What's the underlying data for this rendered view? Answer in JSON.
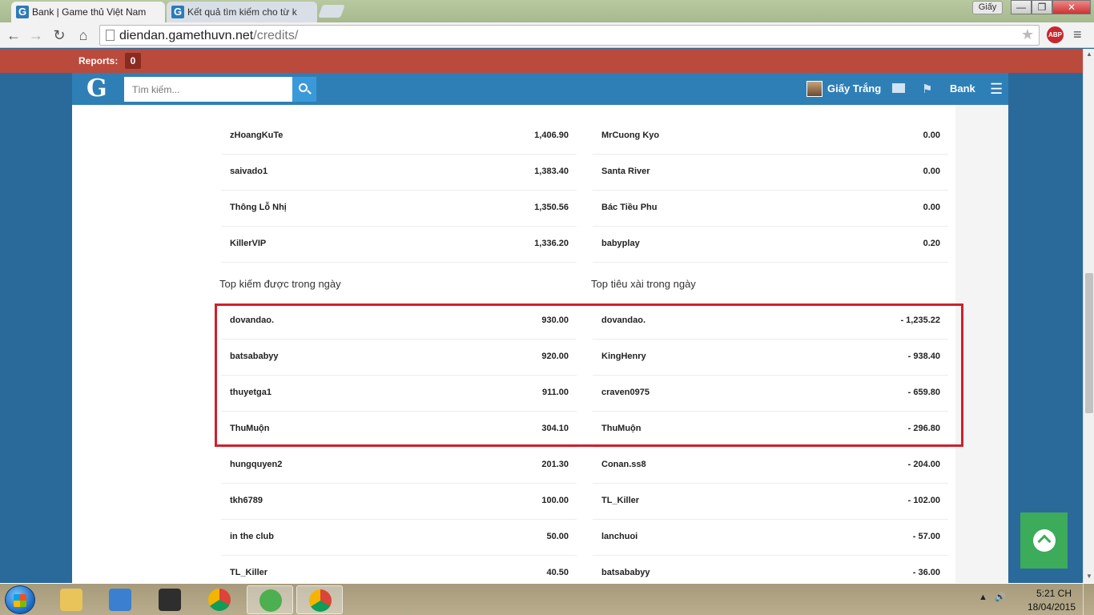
{
  "browser": {
    "tabs": [
      {
        "title": "Bank | Game thủ Việt Nam",
        "favicon": "G",
        "active": true
      },
      {
        "title": "Kết quả tìm kiếm cho từ k",
        "favicon": "G",
        "active": false
      }
    ],
    "profile_label": "Giấy",
    "url_host": "diendan.gamethuvn.net",
    "url_path": "/credits/",
    "abp_label": "ABP"
  },
  "site": {
    "reports_label": "Reports:",
    "reports_count": "0",
    "logo": "G",
    "search_placeholder": "Tìm kiếm...",
    "username": "Giấy Trắng",
    "bank_label": "Bank"
  },
  "top_rows": {
    "left": [
      {
        "name": "zHoangKuTe",
        "amount": "1,406.90"
      },
      {
        "name": "saivado1",
        "amount": "1,383.40"
      },
      {
        "name": "Thông Lỗ Nhị",
        "amount": "1,350.56"
      },
      {
        "name": "KillerVIP",
        "amount": "1,336.20"
      }
    ],
    "right": [
      {
        "name": "MrCuong Kyo",
        "amount": "0.00"
      },
      {
        "name": "Santa River",
        "amount": "0.00"
      },
      {
        "name": "Bác Tiều Phu",
        "amount": "0.00"
      },
      {
        "name": "babyplay",
        "amount": "0.20"
      }
    ]
  },
  "earn_today": {
    "title": "Top kiếm được trong ngày",
    "rows": [
      {
        "name": "dovandao.",
        "amount": "930.00"
      },
      {
        "name": "batsababyy",
        "amount": "920.00"
      },
      {
        "name": "thuyetga1",
        "amount": "911.00"
      },
      {
        "name": "ThuMuộn",
        "amount": "304.10"
      },
      {
        "name": "hungquyen2",
        "amount": "201.30"
      },
      {
        "name": "tkh6789",
        "amount": "100.00"
      },
      {
        "name": "in the club",
        "amount": "50.00"
      },
      {
        "name": "TL_Killer",
        "amount": "40.50"
      }
    ]
  },
  "spend_today": {
    "title": "Top tiêu xài trong ngày",
    "rows": [
      {
        "name": "dovandao.",
        "amount": "- 1,235.22"
      },
      {
        "name": "KingHenry",
        "amount": "- 938.40"
      },
      {
        "name": "craven0975",
        "amount": "- 659.80"
      },
      {
        "name": "ThuMuộn",
        "amount": "- 296.80"
      },
      {
        "name": "Conan.ss8",
        "amount": "- 204.00"
      },
      {
        "name": "TL_Killer",
        "amount": "- 102.00"
      },
      {
        "name": "lanchuoi",
        "amount": "- 57.00"
      },
      {
        "name": "batsababyy",
        "amount": "- 36.00"
      }
    ]
  },
  "taskbar": {
    "time": "5:21 CH",
    "date": "18/04/2015"
  },
  "colors": {
    "reports_bar": "#b94a3c",
    "header": "#2f7fb7",
    "highlight": "#d0202a",
    "scroll_top": "#3cab5a"
  },
  "icons": [
    "search-icon",
    "mail-icon",
    "flag-icon",
    "menu-icon",
    "scroll-top-icon",
    "star-icon",
    "back-icon",
    "forward-icon",
    "reload-icon",
    "home-icon"
  ]
}
